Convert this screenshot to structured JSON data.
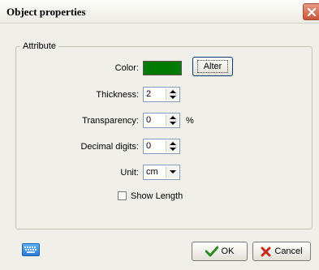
{
  "window": {
    "title": "Object properties"
  },
  "group": {
    "label": "Attribute"
  },
  "fields": {
    "color_label": "Color:",
    "alter_label": "Alter",
    "thickness_label": "Thickness:",
    "thickness_value": "2",
    "transparency_label": "Transparency:",
    "transparency_value": "0",
    "transparency_unit": "%",
    "decimal_label": "Decimal digits:",
    "decimal_value": "0",
    "unit_label": "Unit:",
    "unit_value": "cm",
    "show_length_label": "Show Length",
    "show_length_checked": false
  },
  "buttons": {
    "ok": "OK",
    "cancel": "Cancel"
  },
  "colors": {
    "selected_color": "#007A00"
  },
  "icons": [
    "close-icon",
    "keyboard-icon",
    "check-icon",
    "cross-icon"
  ]
}
